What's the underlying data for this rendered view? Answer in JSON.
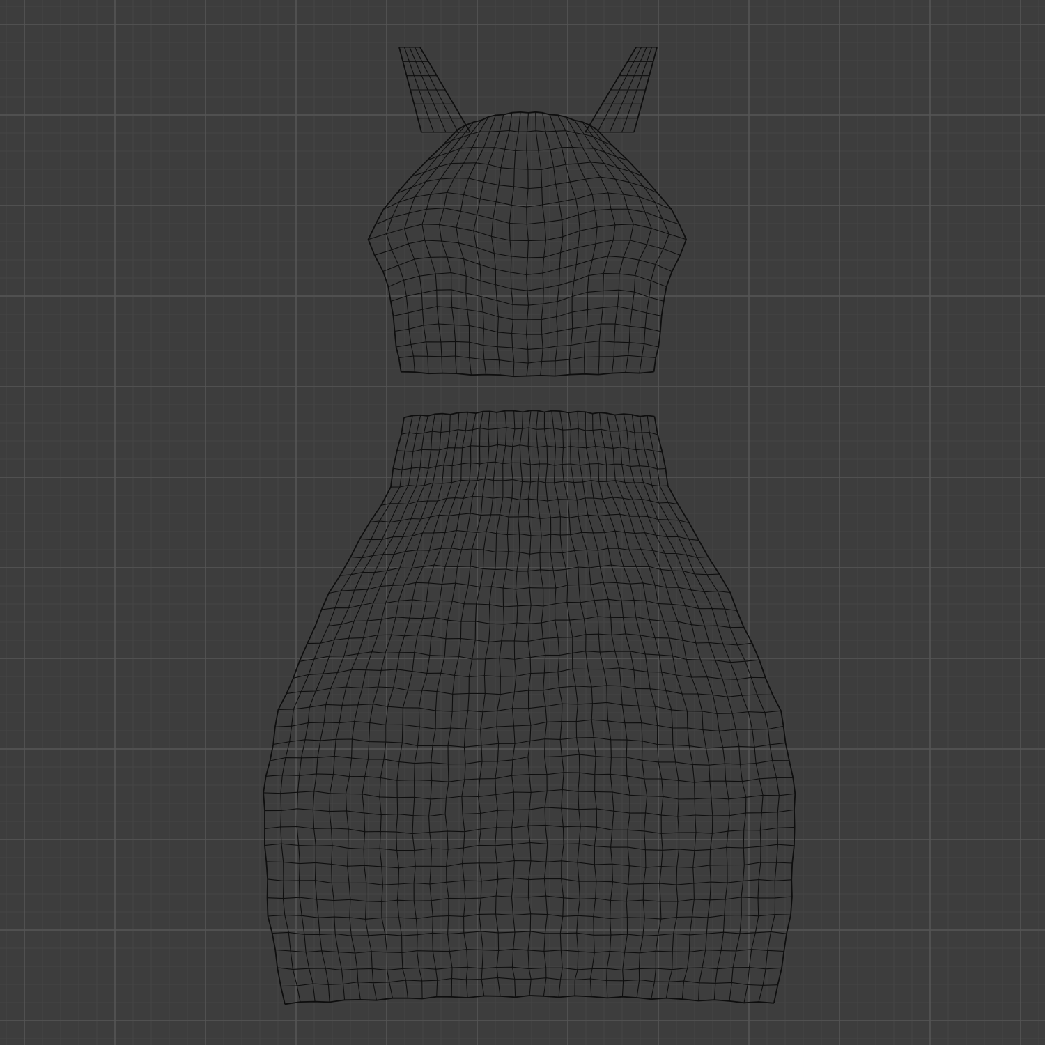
{
  "viewport": {
    "background_color": "#3d3d3d",
    "grid": {
      "visible": true,
      "minor_color": "#454545",
      "major_color": "#565656"
    },
    "shading": "wireframe",
    "wire_color": "#0e0e0e",
    "objects": [
      {
        "name": "crop-top",
        "kind": "wireframe-mesh"
      },
      {
        "name": "skirt",
        "kind": "wireframe-mesh"
      }
    ]
  }
}
